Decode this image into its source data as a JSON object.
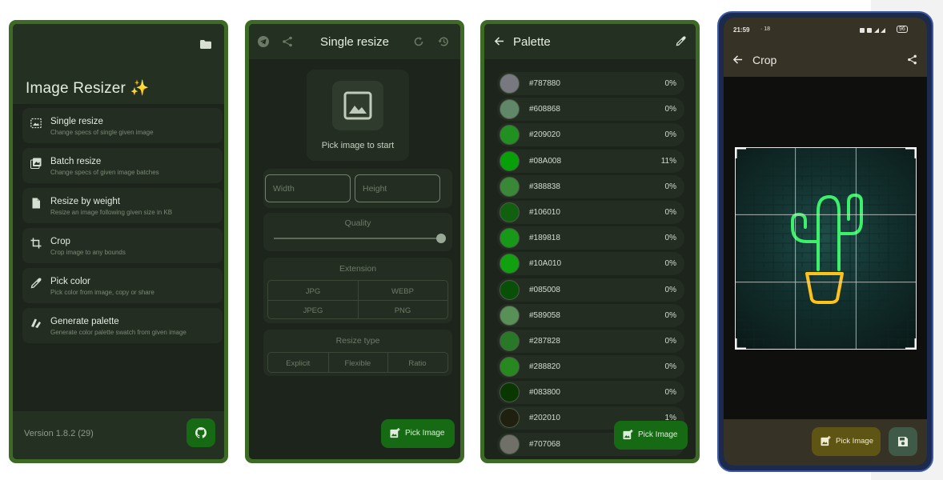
{
  "screen1": {
    "title": "Image Resizer ✨",
    "menu": [
      {
        "title": "Single resize",
        "subtitle": "Change specs of single given image"
      },
      {
        "title": "Batch resize",
        "subtitle": "Change specs of given image batches"
      },
      {
        "title": "Resize by weight",
        "subtitle": "Resize an image following given size in KB"
      },
      {
        "title": "Crop",
        "subtitle": "Crop image to any bounds"
      },
      {
        "title": "Pick color",
        "subtitle": "Pick color from image, copy or share"
      },
      {
        "title": "Generate palette",
        "subtitle": "Generate color palette swatch from given image"
      }
    ],
    "version": "Version 1.8.2 (29)",
    "icons": [
      "folder-icon",
      "single-resize-icon",
      "batch-resize-icon",
      "file-icon",
      "crop-icon",
      "eyedropper-icon",
      "palette-icon",
      "github-icon"
    ]
  },
  "screen2": {
    "title": "Single resize",
    "pick_label": "Pick image to start",
    "width_placeholder": "Width",
    "height_placeholder": "Height",
    "quality_label": "Quality",
    "quality_value": 1.0,
    "extension_label": "Extension",
    "extensions": [
      "JPG",
      "WEBP",
      "JPEG",
      "PNG"
    ],
    "resize_type_label": "Resize type",
    "resize_types": [
      "Explicit",
      "Flexible",
      "Ratio"
    ],
    "fab_label": "Pick Image"
  },
  "screen3": {
    "title": "Palette",
    "colors": [
      {
        "hex": "#787880",
        "pct": "0%"
      },
      {
        "hex": "#608868",
        "pct": "0%"
      },
      {
        "hex": "#209020",
        "pct": "0%"
      },
      {
        "hex": "#08A008",
        "pct": "11%"
      },
      {
        "hex": "#388838",
        "pct": "0%"
      },
      {
        "hex": "#106010",
        "pct": "0%"
      },
      {
        "hex": "#189818",
        "pct": "0%"
      },
      {
        "hex": "#10A010",
        "pct": "0%"
      },
      {
        "hex": "#085008",
        "pct": "0%"
      },
      {
        "hex": "#589058",
        "pct": "0%"
      },
      {
        "hex": "#287828",
        "pct": "0%"
      },
      {
        "hex": "#288820",
        "pct": "0%"
      },
      {
        "hex": "#083800",
        "pct": "0%"
      },
      {
        "hex": "#202010",
        "pct": "1%"
      },
      {
        "hex": "#707068",
        "pct": ""
      }
    ],
    "fab_label": "Pick Image"
  },
  "screen4": {
    "status_time": "21:59",
    "status_extra": "· 18",
    "battery": "96",
    "title": "Crop",
    "fab_label": "Pick Image"
  },
  "colors": {
    "frame_green": "#3d6a25",
    "fab_green": "#166a14",
    "crop_fab": "#5e5414"
  }
}
